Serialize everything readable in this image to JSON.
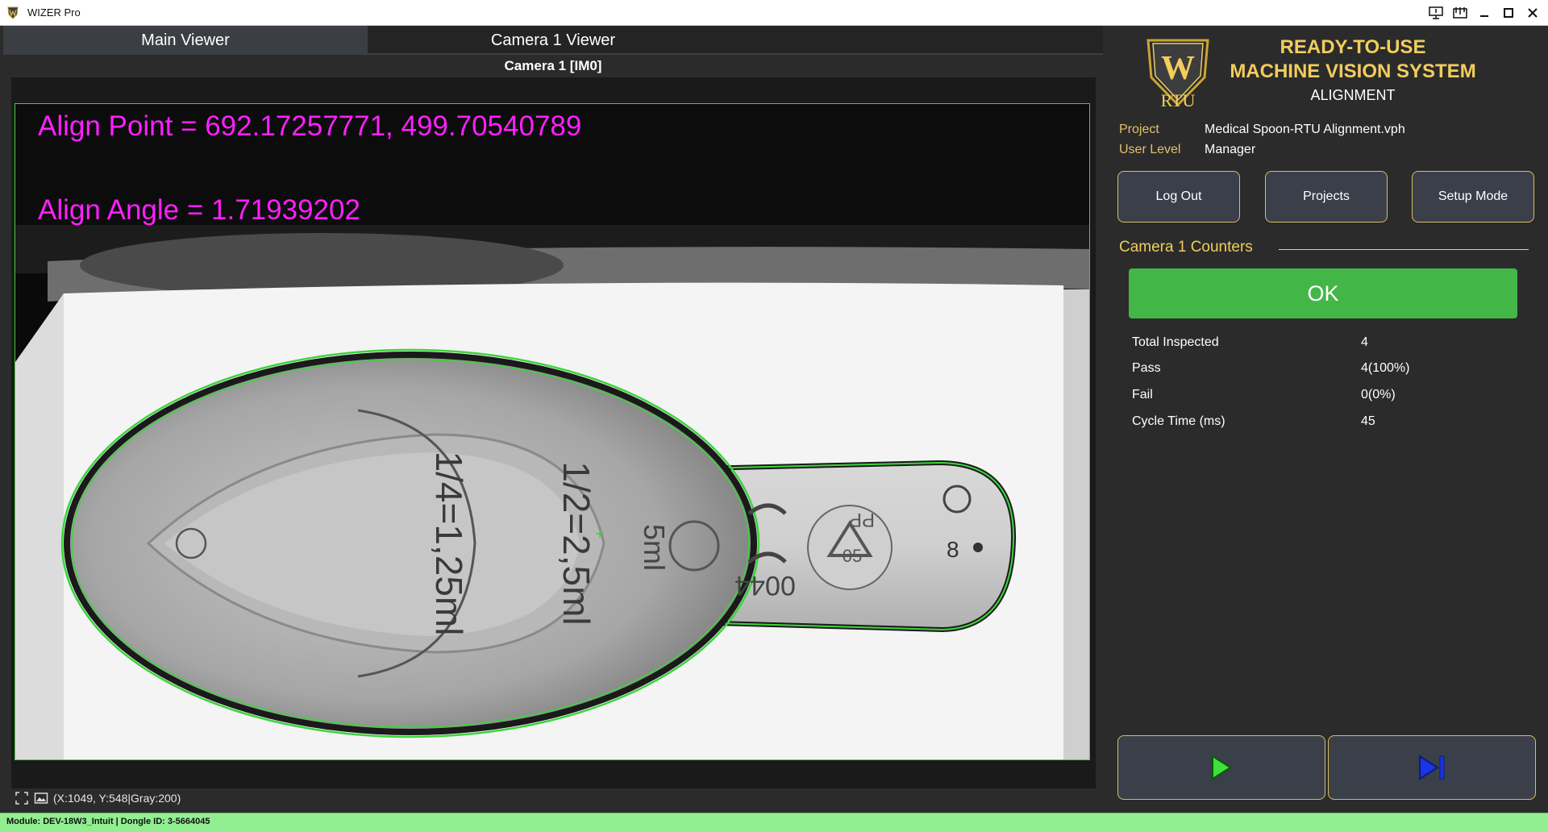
{
  "window": {
    "title": "WIZER Pro"
  },
  "tabs": [
    {
      "label": "Main Viewer"
    },
    {
      "label": "Camera 1 Viewer"
    }
  ],
  "camera_title": "Camera 1  [IM0]",
  "overlay": {
    "align_point": "Align Point = 692.17257771, 499.70540789",
    "align_angle": "Align Angle = 1.71939202"
  },
  "status_coords": "(X:1049, Y:548|Gray:200)",
  "bottom_status": "Module: DEV-18W3_Intuit | Dongle ID: 3-5664045",
  "header": {
    "line1": "READY-TO-USE",
    "line2": "MACHINE VISION SYSTEM",
    "subtitle": "ALIGNMENT",
    "logo_letter": "W",
    "logo_text": "RTU"
  },
  "info": {
    "project_label": "Project",
    "project_value": "Medical Spoon-RTU Alignment.vph",
    "user_level_label": "User Level",
    "user_level_value": "Manager"
  },
  "buttons": {
    "logout": "Log Out",
    "projects": "Projects",
    "setup": "Setup Mode"
  },
  "counters": {
    "title": "Camera 1 Counters",
    "status": "OK",
    "rows": [
      {
        "label": "Total Inspected",
        "value": "4"
      },
      {
        "label": "Pass",
        "value": "4(100%)"
      },
      {
        "label": "Fail",
        "value": "0(0%)"
      },
      {
        "label": "Cycle Time (ms)",
        "value": "45"
      }
    ]
  },
  "spoon_markings": {
    "bowl_text_1": "1/4=1,25ml",
    "bowl_text_2": "1/2=2,5ml",
    "handle_ml": "5ml",
    "handle_code": "0044",
    "recycle_code": "05",
    "recycle_pp": "PP",
    "handle_num": "8"
  },
  "colors": {
    "accent_gold": "#f2cd5c",
    "ok_green": "#44b648",
    "overlay_magenta": "#ff1fff",
    "outline_green": "#3cd43c",
    "status_green": "#91ee91",
    "play_green": "#3fe03f",
    "step_blue": "#1a34e6"
  },
  "icons": {
    "run": "play-icon",
    "step": "step-forward-icon"
  }
}
